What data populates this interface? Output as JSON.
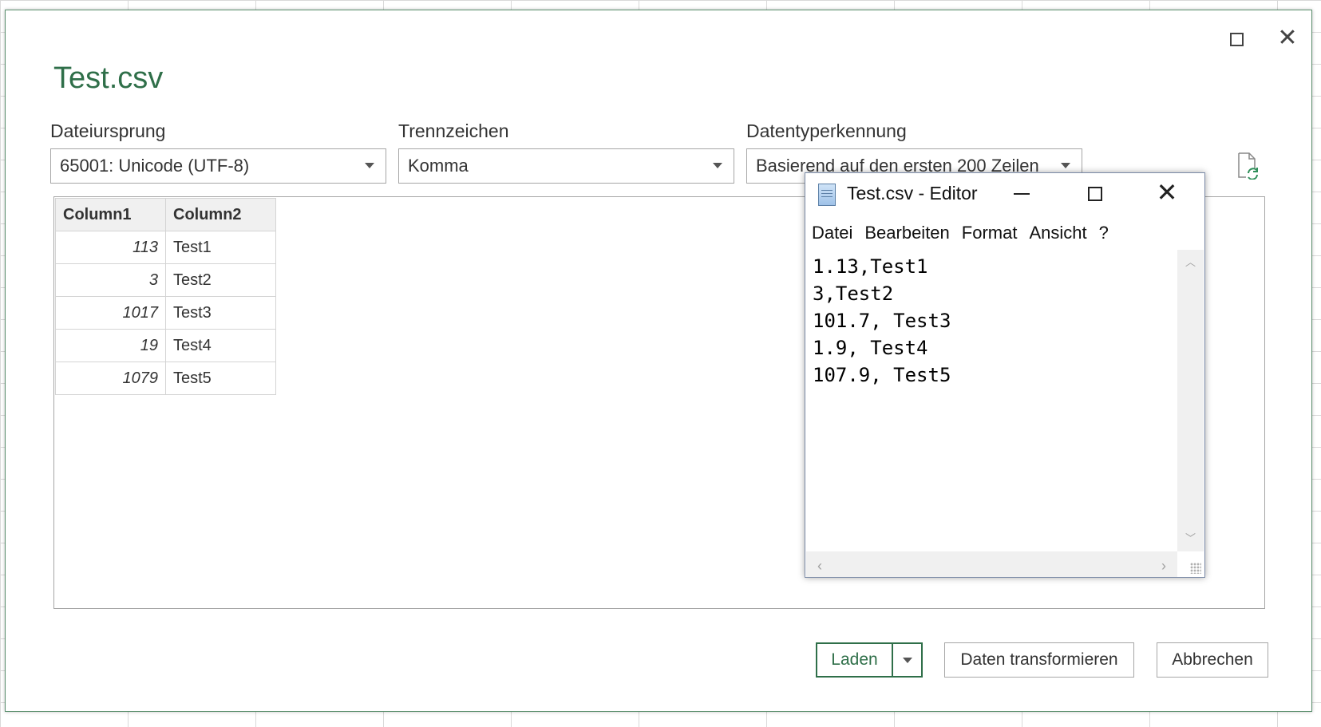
{
  "dialog": {
    "title": "Test.csv",
    "file_origin": {
      "label": "Dateiursprung",
      "value": "65001: Unicode (UTF-8)"
    },
    "delimiter": {
      "label": "Trennzeichen",
      "value": "Komma"
    },
    "type_detection": {
      "label": "Datentyperkennung",
      "value": "Basierend auf den ersten 200 Zeilen"
    },
    "table": {
      "headers": [
        "Column1",
        "Column2"
      ],
      "rows": [
        [
          "113",
          "Test1"
        ],
        [
          "3",
          "Test2"
        ],
        [
          "1017",
          "Test3"
        ],
        [
          "19",
          "Test4"
        ],
        [
          "1079",
          "Test5"
        ]
      ]
    },
    "buttons": {
      "load": "Laden",
      "transform": "Daten transformieren",
      "cancel": "Abbrechen"
    }
  },
  "notepad": {
    "title": "Test.csv - Editor",
    "menu": [
      "Datei",
      "Bearbeiten",
      "Format",
      "Ansicht",
      "?"
    ],
    "lines": [
      "1.13,Test1",
      "3,Test2",
      "101.7, Test3",
      "1.9, Test4",
      "107.9, Test5"
    ]
  },
  "icons": {
    "dialog_maximize": "maximize-icon",
    "dialog_close": "close-icon",
    "refresh": "file-refresh-icon"
  },
  "colors": {
    "accent": "#2f6f49"
  }
}
